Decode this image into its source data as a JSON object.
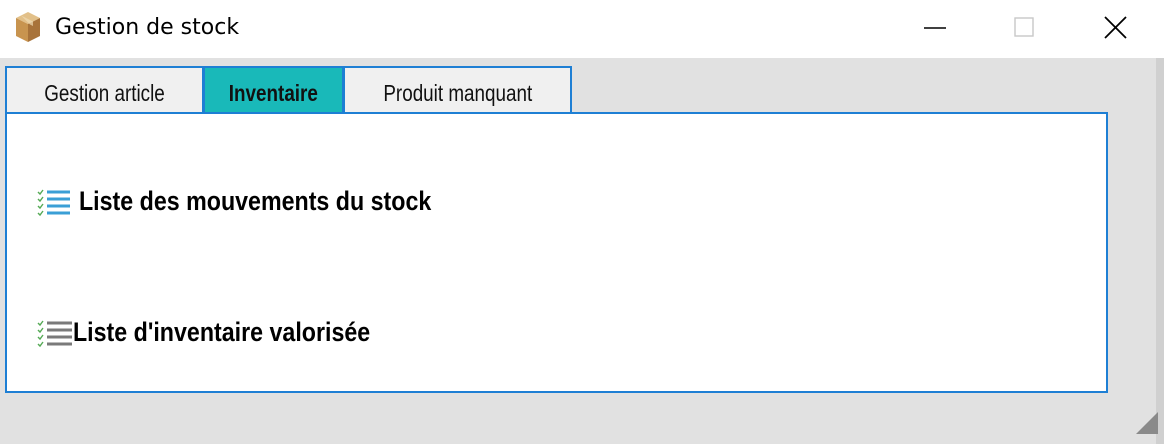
{
  "window": {
    "title": "Gestion de stock",
    "icon": "package-box-icon"
  },
  "titlebar_buttons": {
    "minimize": "minimize-icon",
    "maximize": "maximize-icon",
    "close": "close-icon"
  },
  "tabs": [
    {
      "label": "Gestion article",
      "selected": false
    },
    {
      "label": "Inventaire",
      "selected": true
    },
    {
      "label": "Produit manquant",
      "selected": false
    }
  ],
  "links": [
    {
      "label": "Liste des mouvements du stock",
      "icon": "checklist-icon"
    },
    {
      "label": "Liste d'inventaire valorisée",
      "icon": "checklist-icon"
    }
  ],
  "colors": {
    "accent_border": "#1e7fd4",
    "selected_tab": "#19b9b9"
  }
}
